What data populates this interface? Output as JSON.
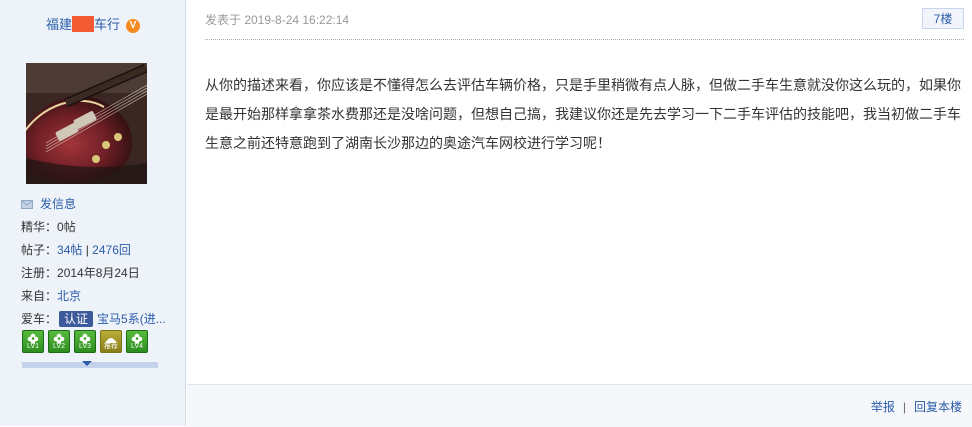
{
  "user": {
    "name_prefix": "福建",
    "name_suffix": "车行",
    "verified_badge": "V"
  },
  "profile": {
    "message_label": "发信息",
    "jinghua_label": "精华：",
    "jinghua_value": "0帖",
    "posts_label": "帖子：",
    "posts_count": "34帖",
    "posts_sep": " | ",
    "replies_count": "2476回",
    "register_label": "注册：",
    "register_date": "2014年8月24日",
    "from_label": "来自：",
    "from_value": "北京",
    "car_label": "爱车：",
    "car_cert": "认证",
    "car_value": "宝马5系(进..."
  },
  "badges": [
    {
      "icon": "flower-icon",
      "label": "LV1",
      "color": "#3a9c26"
    },
    {
      "icon": "flower-icon",
      "label": "LV2",
      "color": "#3a9c26"
    },
    {
      "icon": "flower-icon",
      "label": "LV3",
      "color": "#3a9c26"
    },
    {
      "icon": "recommend-icon",
      "label": "推荐",
      "color": "#a39427"
    },
    {
      "icon": "flower-icon",
      "label": "LV4",
      "color": "#3a9c26"
    }
  ],
  "post": {
    "posted_at": "发表于 2019-8-24 16:22:14",
    "floor": "7楼",
    "content": "从你的描述来看，你应该是不懂得怎么去评估车辆价格，只是手里稍微有点人脉，但做二手车生意就没你这么玩的，如果你是最开始那样拿拿茶水费那还是没啥问题，但想自己搞，我建议你还是先去学习一下二手车评估的技能吧，我当初做二手车生意之前还特意跑到了湖南长沙那边的奥途汽车网校进行学习呢！"
  },
  "footer": {
    "report": "举报",
    "separator": "|",
    "reply": "回复本楼"
  },
  "colors": {
    "link": "#2a5caa",
    "sidebar_bg": "#eef2f9",
    "redact": "#f35a32",
    "v_badge": "#f58a1f"
  }
}
